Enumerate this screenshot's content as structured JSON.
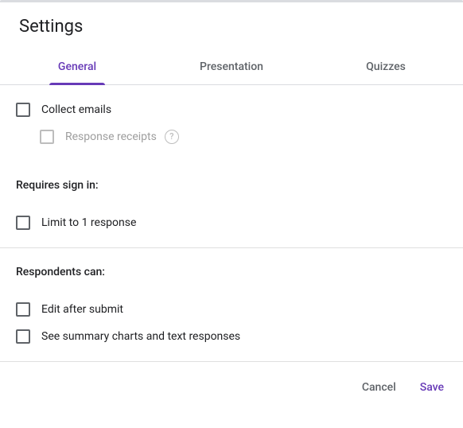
{
  "title": "Settings",
  "tabs": {
    "general": "General",
    "presentation": "Presentation",
    "quizzes": "Quizzes"
  },
  "collect_emails_label": "Collect emails",
  "response_receipts_label": "Response receipts",
  "requires_signin_heading": "Requires sign in:",
  "limit_one_label": "Limit to 1 response",
  "respondents_can_heading": "Respondents can:",
  "edit_after_label": "Edit after submit",
  "see_summary_label": "See summary charts and text responses",
  "footer": {
    "cancel": "Cancel",
    "save": "Save"
  }
}
